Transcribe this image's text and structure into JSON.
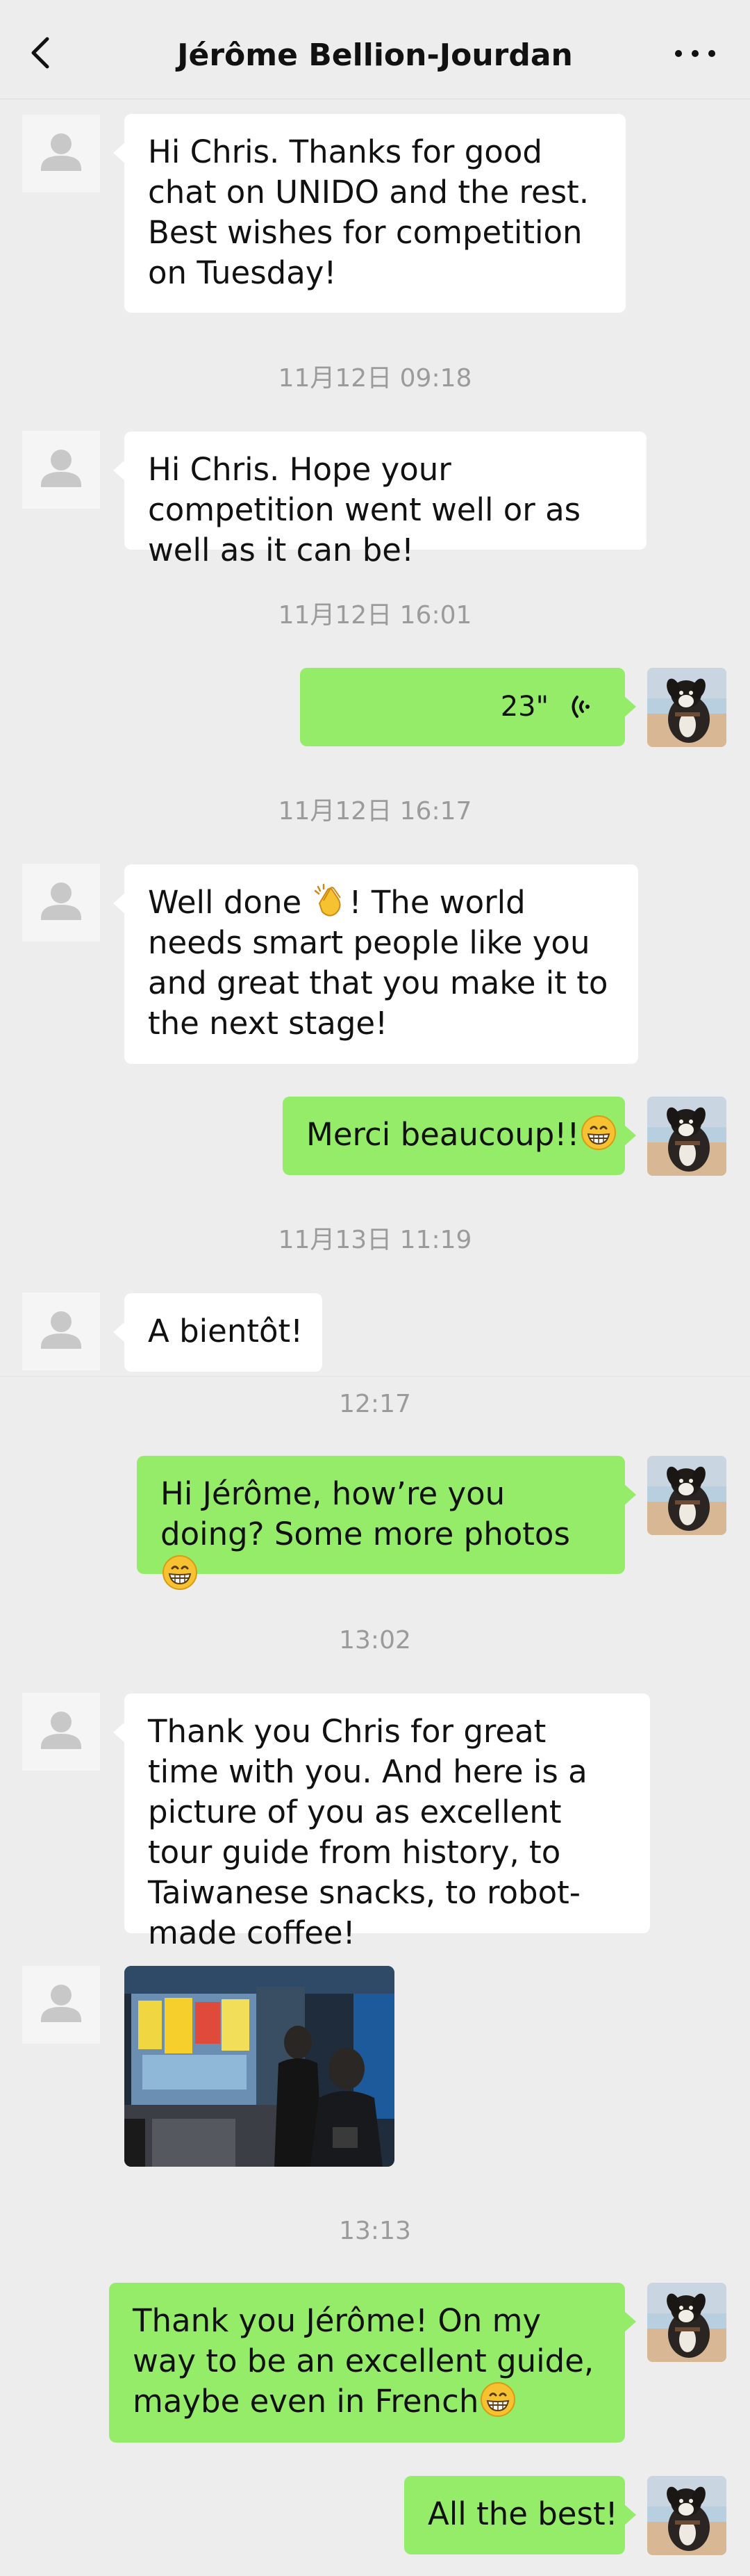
{
  "header": {
    "title": "Jérôme Bellion-Jourdan",
    "back_icon": "chevron-left-icon",
    "more_icon": "more-horizontal-icon"
  },
  "colors": {
    "background": "#ededed",
    "incoming_bubble": "#ffffff",
    "outgoing_bubble": "#95ec69",
    "timestamp": "#9b9b9b"
  },
  "messages": [
    {
      "sender": "contact",
      "text": "Hi Chris. Thanks for good chat on UNIDO and the rest. Best wishes for competition on Tuesday!"
    },
    {
      "type": "timestamp",
      "text": "11月12日 09:18"
    },
    {
      "sender": "contact",
      "text": "Hi Chris. Hope your competition went well or as well as it can be!"
    },
    {
      "type": "timestamp",
      "text": "11月12日 16:01"
    },
    {
      "sender": "me",
      "type": "voice",
      "duration": "23\""
    },
    {
      "type": "timestamp",
      "text": "11月12日 16:17"
    },
    {
      "sender": "contact",
      "text": "Well done",
      "emoji": "clapping-hands-emoji",
      "text_after": "! The world needs smart people like you and great that you make it to the next stage!"
    },
    {
      "sender": "me",
      "text": "Merci beaucoup!!",
      "emoji": "grinning-emoji"
    },
    {
      "type": "timestamp",
      "text": "11月13日 11:19"
    },
    {
      "sender": "contact",
      "text": "A bientôt!"
    },
    {
      "type": "timestamp",
      "text": "12:17"
    },
    {
      "sender": "me",
      "text": "Hi Jérôme, how’re you doing? Some more photos",
      "emoji": "grinning-emoji"
    },
    {
      "type": "timestamp",
      "text": "13:02"
    },
    {
      "sender": "contact",
      "text": "Thank you Chris for great time with you. And here is a picture of you as excellent tour guide from history, to Taiwanese snacks, to robot-made coffee!"
    },
    {
      "sender": "contact",
      "type": "image",
      "content": "photo-at-food-stall"
    },
    {
      "type": "timestamp",
      "text": "13:13"
    },
    {
      "sender": "me",
      "text": "Thank you Jérôme! On my way to be an excellent guide, maybe even in French",
      "emoji": "grinning-emoji"
    },
    {
      "sender": "me",
      "text": "All the best!"
    }
  ]
}
